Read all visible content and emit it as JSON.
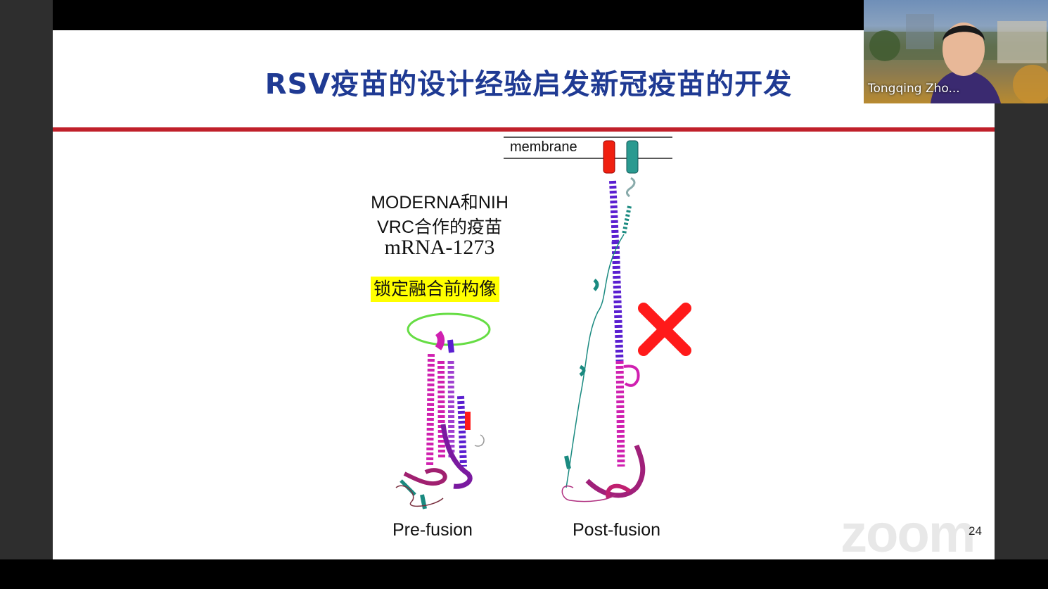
{
  "meeting": {
    "participant_name": "Tongqing Zho...",
    "watermark": "zoom"
  },
  "slide": {
    "title": "RSV疫苗的设计经验启发新冠疫苗的开发",
    "membrane_label": "membrane",
    "vaccine_lines": [
      "MODERNA和NIH",
      "VRC合作的疫苗",
      "mRNA-1273"
    ],
    "highlight_text": "锁定融合前构像",
    "captions": {
      "pre": "Pre-fusion",
      "post": "Post-fusion"
    },
    "page_number": "24"
  },
  "colors": {
    "title": "#1f3a93",
    "rule": "#c0202a",
    "highlight": "#ffff00",
    "helix_purple": "#5a1fd0",
    "helix_magenta": "#d020b0",
    "teal": "#1a8a80",
    "red": "#ff1a1a",
    "oval": "#66dd44"
  },
  "icons": [
    "red-x-icon",
    "zoom-logo"
  ]
}
